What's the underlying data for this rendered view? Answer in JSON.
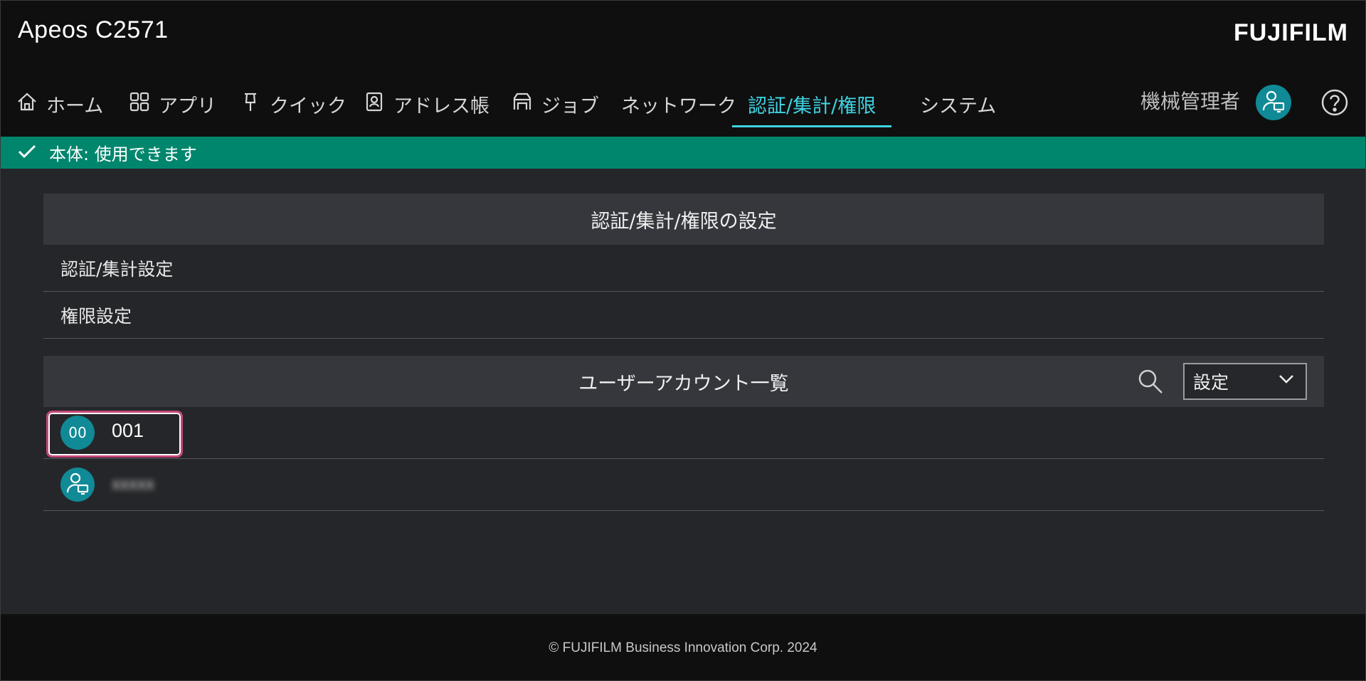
{
  "header": {
    "device_title": "Apeos C2571",
    "brand": "FUJIFILM",
    "admin_label": "機械管理者"
  },
  "nav": {
    "items": [
      {
        "label": "ホーム",
        "icon": "home-icon"
      },
      {
        "label": "アプリ",
        "icon": "apps-icon"
      },
      {
        "label": "クイック",
        "icon": "pin-icon"
      },
      {
        "label": "アドレス帳",
        "icon": "address-book-icon"
      },
      {
        "label": "ジョブ",
        "icon": "job-icon"
      },
      {
        "label": "ネットワーク",
        "icon": ""
      },
      {
        "label": "認証/集計/権限",
        "icon": "",
        "active": true
      },
      {
        "label": "システム",
        "icon": ""
      }
    ]
  },
  "status": {
    "text": "本体: 使用できます",
    "color": "#00866d"
  },
  "auth_section": {
    "title": "認証/集計/権限の設定",
    "items": [
      "認証/集計設定",
      "権限設定"
    ]
  },
  "user_section": {
    "title": "ユーザーアカウント一覧",
    "dropdown_value": "設定",
    "users": [
      {
        "avatar_text": "00",
        "name": "001",
        "focused": true
      },
      {
        "avatar_text": "",
        "name": "xxxxx",
        "blurred": true
      }
    ]
  },
  "footer": {
    "copyright": "© FUJIFILM Business Innovation Corp. 2024"
  },
  "colors": {
    "accent": "#3fd3e2",
    "avatar": "#0f8a96",
    "focus_ring": "#c2487a"
  }
}
